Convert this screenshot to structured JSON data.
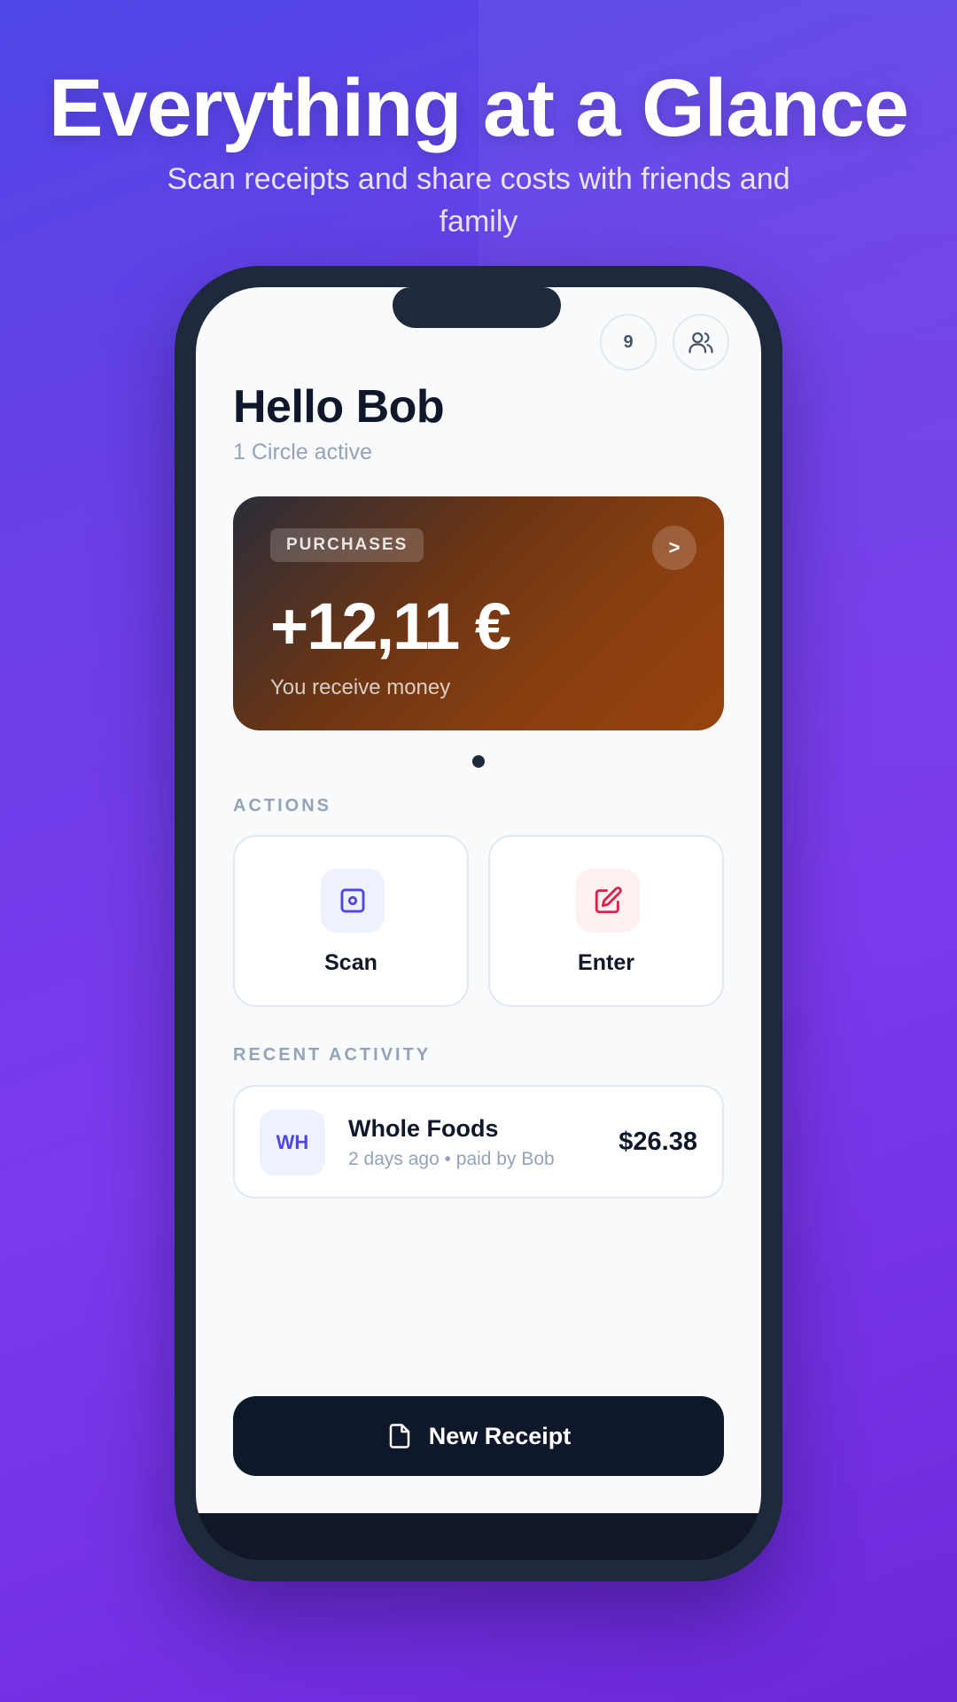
{
  "hero": {
    "title": "Everything at a Glance",
    "subtitle": "Scan receipts and share costs with friends and family"
  },
  "header": {
    "notification_count": "9",
    "people_icon": "users-icon"
  },
  "greeting": {
    "title": "Hello Bob",
    "status": "1 Circle active"
  },
  "balance_card": {
    "tag": "PURCHASES",
    "arrow": ">",
    "amount": "+12,11 €",
    "caption": "You receive money",
    "colors": {
      "start": "#2b2d3a",
      "end": "#96430d"
    }
  },
  "pager": {
    "count": 1,
    "active": 0
  },
  "actions": {
    "label": "ACTIONS",
    "items": [
      {
        "label": "Scan",
        "icon": "scan-icon",
        "color": "#4f46e5"
      },
      {
        "label": "Enter",
        "icon": "edit-icon",
        "color": "#e11d48"
      }
    ]
  },
  "recent": {
    "label": "RECENT ACTIVITY",
    "items": [
      {
        "initials": "WH",
        "name": "Whole Foods",
        "meta": "2 days ago • paid by Bob",
        "amount": "$26.38"
      }
    ]
  },
  "cta": {
    "label": "New Receipt",
    "icon": "file-icon"
  }
}
